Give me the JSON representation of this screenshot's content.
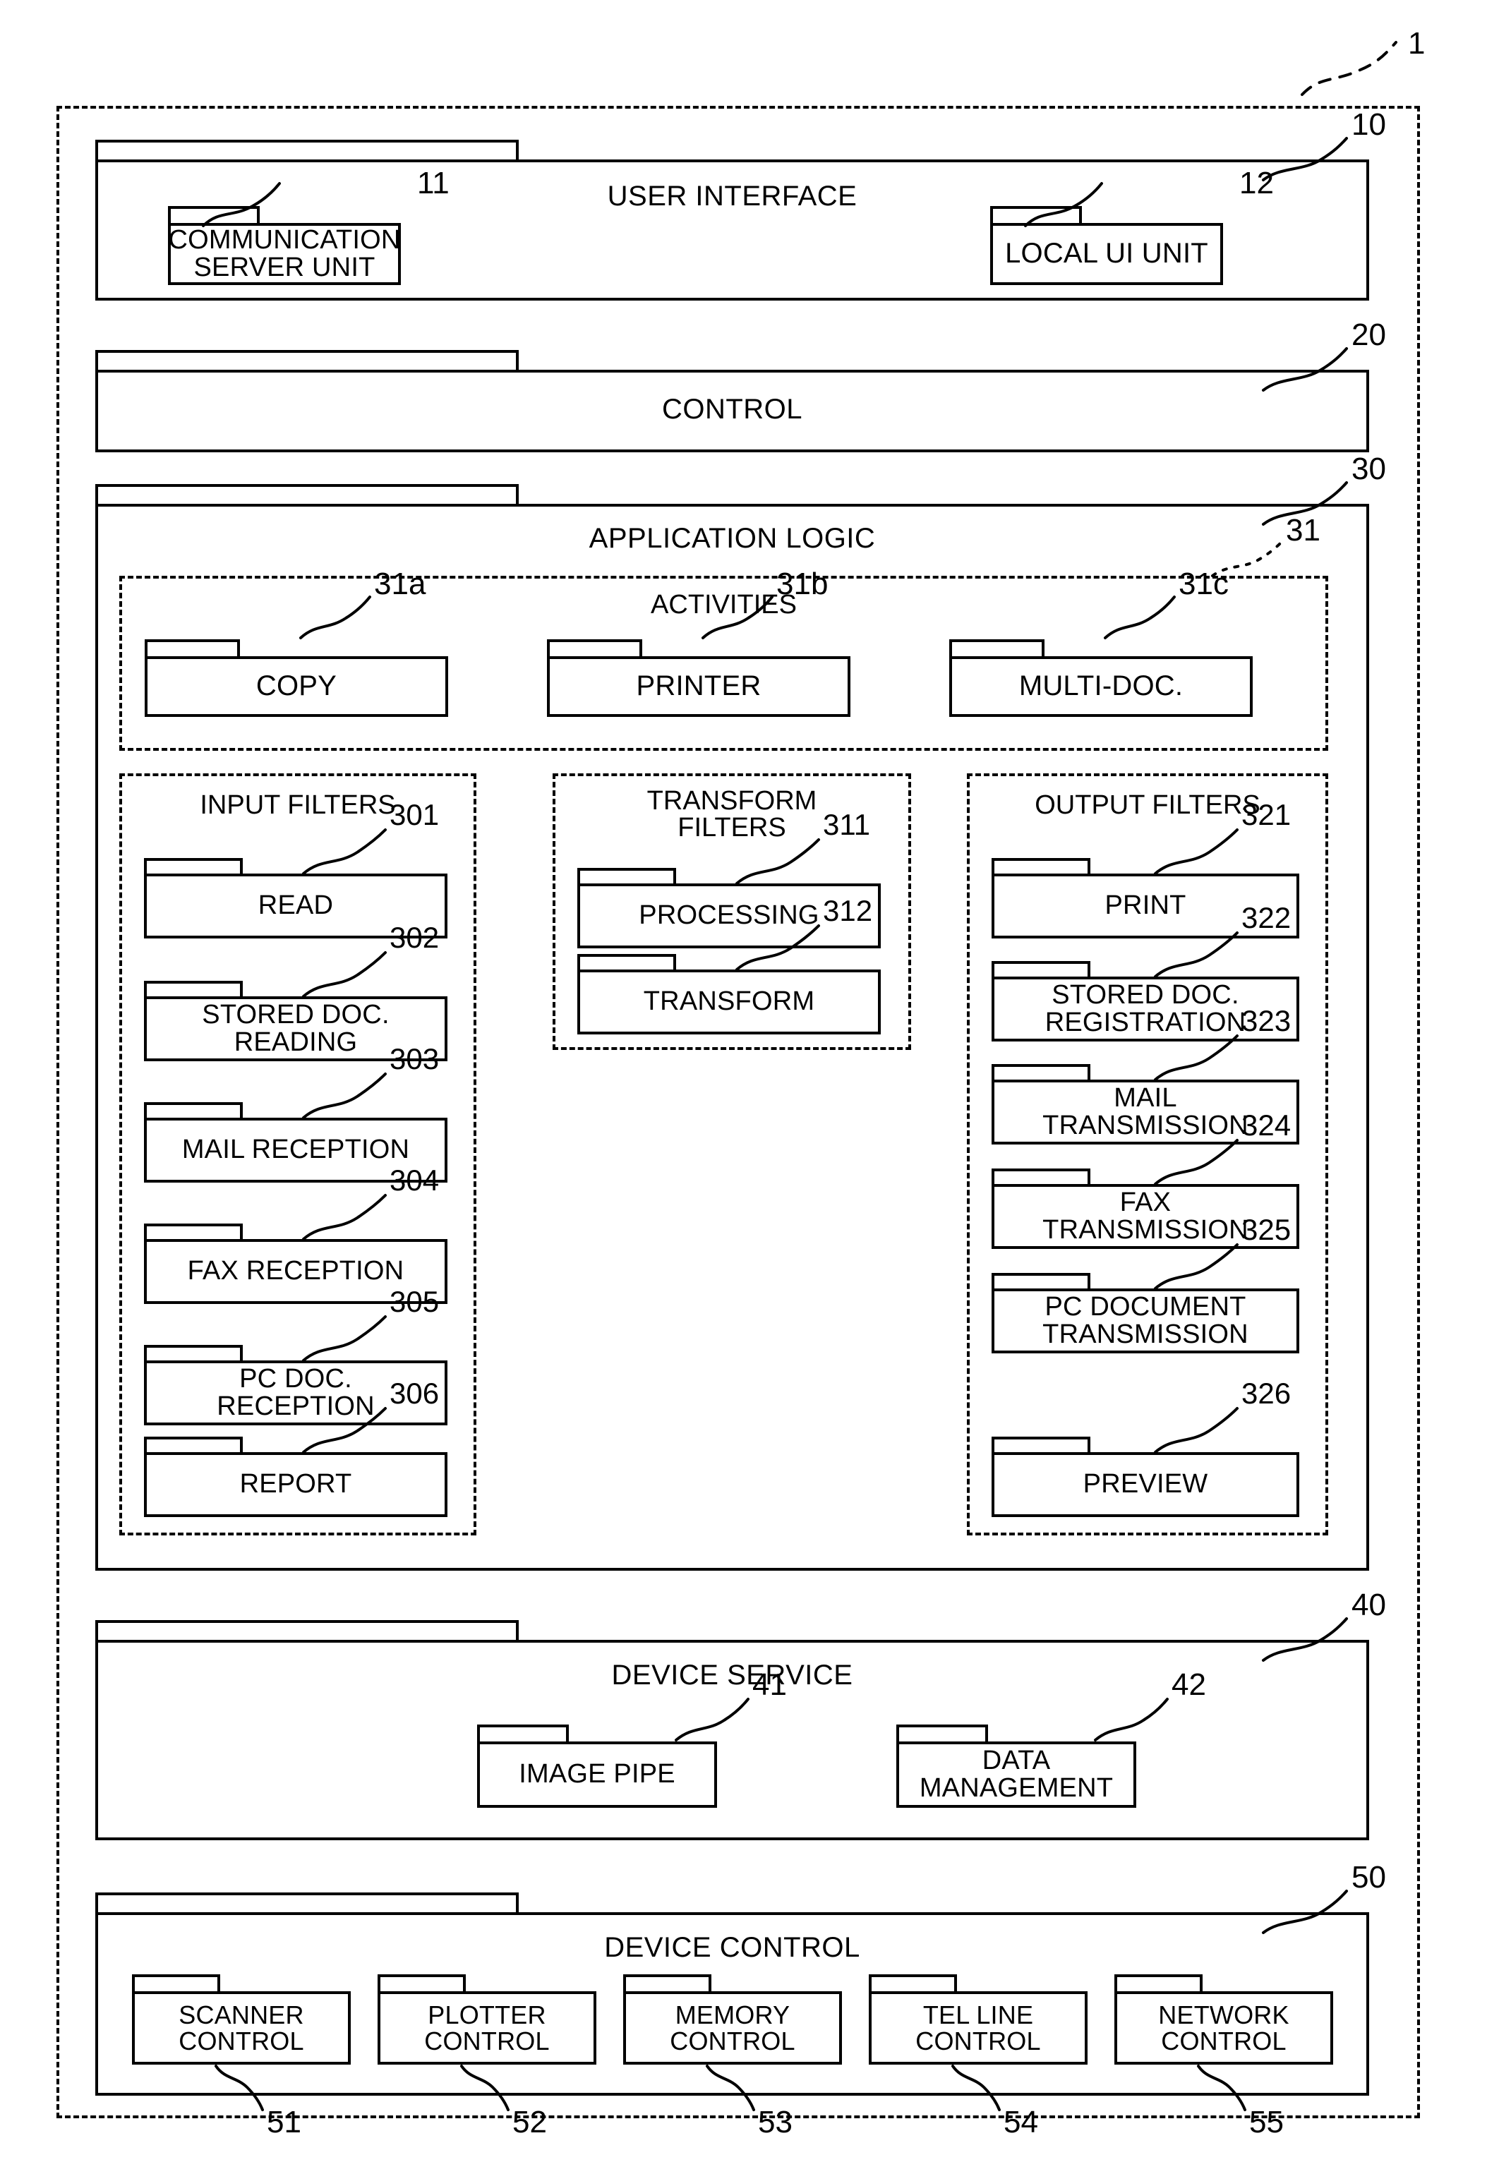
{
  "figure": {
    "system_ref": "1"
  },
  "layers": [
    {
      "ref": "10",
      "title": "USER INTERFACE",
      "modules": [
        {
          "ref": "11",
          "label": "COMMUNICATION\nSERVER UNIT"
        },
        {
          "ref": "12",
          "label": "LOCAL UI UNIT"
        }
      ]
    },
    {
      "ref": "20",
      "title": "CONTROL",
      "modules": []
    },
    {
      "ref": "30",
      "title": "APPLICATION LOGIC",
      "groups": [
        {
          "ref": "31",
          "title": "ACTIVITIES",
          "modules": [
            {
              "ref": "31a",
              "label": "COPY"
            },
            {
              "ref": "31b",
              "label": "PRINTER"
            },
            {
              "ref": "31c",
              "label": "MULTI-DOC."
            }
          ]
        },
        {
          "ref": "",
          "title": "INPUT FILTERS",
          "modules": [
            {
              "ref": "301",
              "label": "READ"
            },
            {
              "ref": "302",
              "label": "STORED DOC.\nREADING"
            },
            {
              "ref": "303",
              "label": "MAIL RECEPTION"
            },
            {
              "ref": "304",
              "label": "FAX RECEPTION"
            },
            {
              "ref": "305",
              "label": "PC DOC.\nRECEPTION"
            },
            {
              "ref": "306",
              "label": "REPORT"
            }
          ]
        },
        {
          "ref": "",
          "title": "TRANSFORM\nFILTERS",
          "modules": [
            {
              "ref": "311",
              "label": "PROCESSING"
            },
            {
              "ref": "312",
              "label": "TRANSFORM"
            }
          ]
        },
        {
          "ref": "",
          "title": "OUTPUT FILTERS",
          "modules": [
            {
              "ref": "321",
              "label": "PRINT"
            },
            {
              "ref": "322",
              "label": "STORED DOC.\nREGISTRATION"
            },
            {
              "ref": "323",
              "label": "MAIL\nTRANSMISSION"
            },
            {
              "ref": "324",
              "label": "FAX\nTRANSMISSION"
            },
            {
              "ref": "325",
              "label": "PC DOCUMENT\nTRANSMISSION"
            },
            {
              "ref": "326",
              "label": "PREVIEW"
            }
          ]
        }
      ]
    },
    {
      "ref": "40",
      "title": "DEVICE SERVICE",
      "modules": [
        {
          "ref": "41",
          "label": "IMAGE PIPE"
        },
        {
          "ref": "42",
          "label": "DATA\nMANAGEMENT"
        }
      ]
    },
    {
      "ref": "50",
      "title": "DEVICE CONTROL",
      "modules": [
        {
          "ref": "51",
          "label": "SCANNER\nCONTROL"
        },
        {
          "ref": "52",
          "label": "PLOTTER\nCONTROL"
        },
        {
          "ref": "53",
          "label": "MEMORY\nCONTROL"
        },
        {
          "ref": "54",
          "label": "TEL LINE\nCONTROL"
        },
        {
          "ref": "55",
          "label": "NETWORK\nCONTROL"
        }
      ]
    }
  ],
  "labels": {
    "sys": "1",
    "ui": "10",
    "ui_comm": "11",
    "ui_local": "12",
    "control": "20",
    "applogic": "30",
    "activities": "31",
    "act_copy": "31a",
    "act_printer": "31b",
    "act_multidoc": "31c",
    "if_301": "301",
    "if_302": "302",
    "if_303": "303",
    "if_304": "304",
    "if_305": "305",
    "if_306": "306",
    "tf_311": "311",
    "tf_312": "312",
    "of_321": "321",
    "of_322": "322",
    "of_323": "323",
    "of_324": "324",
    "of_325": "325",
    "of_326": "326",
    "devserv": "40",
    "ds_pipe": "41",
    "ds_data": "42",
    "devctl": "50",
    "dc_51": "51",
    "dc_52": "52",
    "dc_53": "53",
    "dc_54": "54",
    "dc_55": "55"
  },
  "text": {
    "user_interface": "USER INTERFACE",
    "communication_server_unit": "COMMUNICATION\nSERVER UNIT",
    "local_ui_unit": "LOCAL UI UNIT",
    "control": "CONTROL",
    "application_logic": "APPLICATION LOGIC",
    "activities": "ACTIVITIES",
    "copy": "COPY",
    "printer": "PRINTER",
    "multi_doc": "MULTI-DOC.",
    "input_filters": "INPUT FILTERS",
    "read": "READ",
    "stored_doc_reading": "STORED DOC.\nREADING",
    "mail_reception": "MAIL RECEPTION",
    "fax_reception": "FAX RECEPTION",
    "pc_doc_reception": "PC DOC.\nRECEPTION",
    "report": "REPORT",
    "transform_filters": "TRANSFORM\nFILTERS",
    "processing": "PROCESSING",
    "transform": "TRANSFORM",
    "output_filters": "OUTPUT FILTERS",
    "print": "PRINT",
    "stored_doc_registration": "STORED DOC.\nREGISTRATION",
    "mail_transmission": "MAIL\nTRANSMISSION",
    "fax_transmission": "FAX\nTRANSMISSION",
    "pc_document_transmission": "PC DOCUMENT\nTRANSMISSION",
    "preview": "PREVIEW",
    "device_service": "DEVICE SERVICE",
    "image_pipe": "IMAGE PIPE",
    "data_management": "DATA\nMANAGEMENT",
    "device_control": "DEVICE CONTROL",
    "scanner_control": "SCANNER\nCONTROL",
    "plotter_control": "PLOTTER\nCONTROL",
    "memory_control": "MEMORY\nCONTROL",
    "tel_line_control": "TEL LINE\nCONTROL",
    "network_control": "NETWORK\nCONTROL"
  },
  "colors": {
    "ink": "#000000",
    "paper": "#ffffff"
  }
}
